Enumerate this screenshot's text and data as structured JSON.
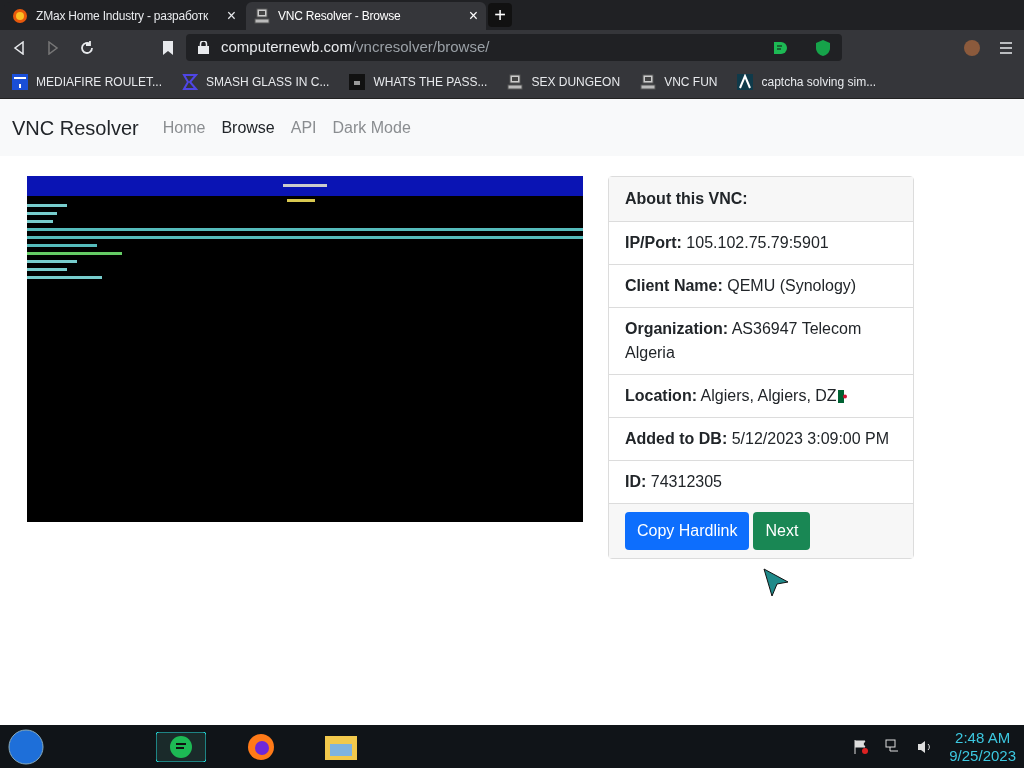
{
  "tabs": [
    {
      "title": "ZMax Home Industry - разработк",
      "selected": false,
      "close": "×"
    },
    {
      "title": "VNC Resolver - Browse",
      "selected": true,
      "close": "×"
    }
  ],
  "new_tab": "+",
  "address": {
    "domain": "computernewb.com",
    "path": "/vncresolver/browse/"
  },
  "bookmarks": [
    {
      "label": "MEDIAFIRE ROULET...",
      "kind": "mf"
    },
    {
      "label": "SMASH GLASS IN C...",
      "kind": "sigma"
    },
    {
      "label": "WHATS THE PASS...",
      "kind": "dark"
    },
    {
      "label": "SEX DUNGEON",
      "kind": "pc"
    },
    {
      "label": "VNC FUN",
      "kind": "pc"
    },
    {
      "label": "captcha solving sim...",
      "kind": "lambda"
    }
  ],
  "navbar": {
    "brand": "VNC Resolver",
    "links": [
      {
        "label": "Home",
        "selected": false
      },
      {
        "label": "Browse",
        "selected": true
      },
      {
        "label": "API",
        "selected": false
      },
      {
        "label": "Dark Mode",
        "selected": false
      }
    ]
  },
  "card": {
    "title": "About this VNC:",
    "fields": [
      {
        "label": "IP/Port:",
        "value": "105.102.75.79:5901",
        "flag": false
      },
      {
        "label": "Client Name:",
        "value": "QEMU (Synology)",
        "flag": false
      },
      {
        "label": "Organization:",
        "value": "AS36947 Telecom Algeria",
        "flag": false
      },
      {
        "label": "Location:",
        "value": "Algiers, Algiers, DZ",
        "flag": true
      },
      {
        "label": "Added to DB:",
        "value": "5/12/2023 3:09:00 PM",
        "flag": false
      },
      {
        "label": "ID:",
        "value": "74312305",
        "flag": false
      }
    ],
    "buttons": [
      {
        "label": "Copy Hardlink",
        "kind": "primary"
      },
      {
        "label": "Next",
        "kind": "success"
      }
    ]
  },
  "taskbar": {
    "time": "2:48 AM",
    "date": "9/25/2023"
  }
}
